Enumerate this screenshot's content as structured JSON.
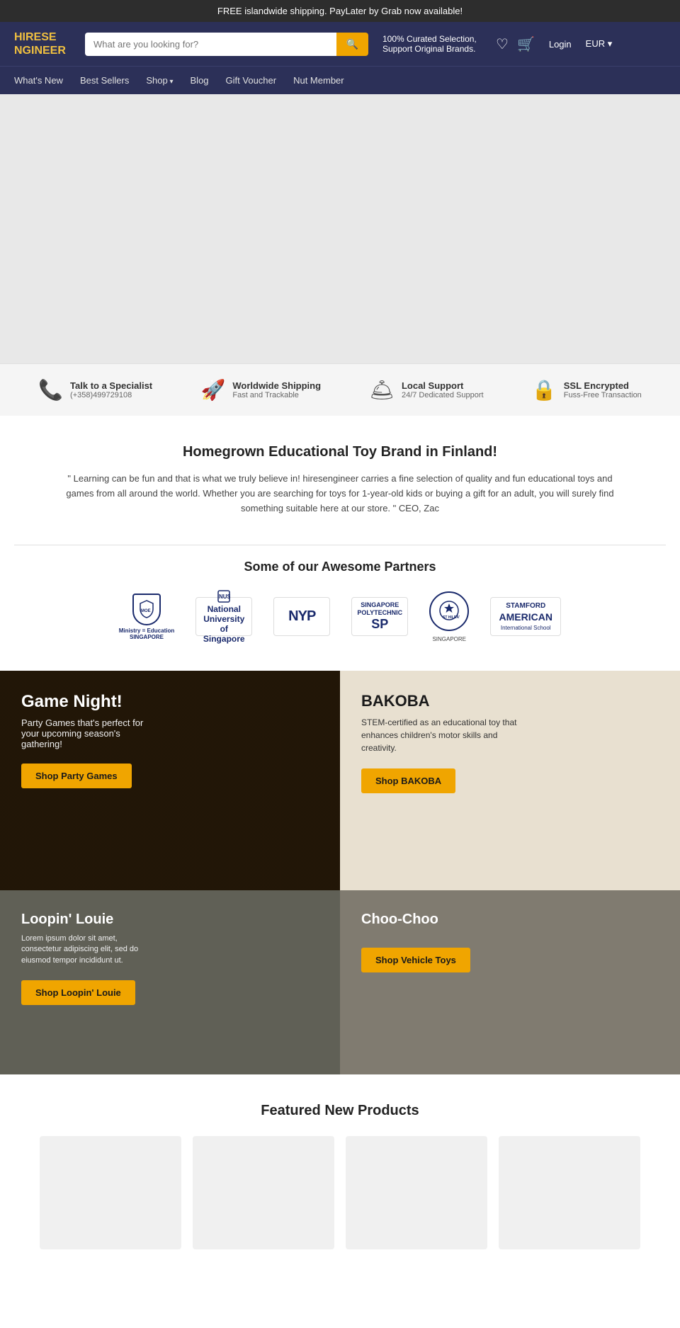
{
  "top_banner": {
    "text": "FREE islandwide shipping. PayLater by Grab now available!"
  },
  "header": {
    "logo_line1": "HIRESE",
    "logo_line2": "NGINEER",
    "search_placeholder": "What are you looking for?",
    "tagline": "100% Curated Selection, Support Original Brands.",
    "login_label": "Login",
    "currency_label": "EUR"
  },
  "nav": {
    "items": [
      {
        "label": "What's New"
      },
      {
        "label": "Best Sellers"
      },
      {
        "label": "Shop",
        "dropdown": true
      },
      {
        "label": "Blog"
      },
      {
        "label": "Gift Voucher"
      },
      {
        "label": "Nut Member"
      }
    ]
  },
  "features": [
    {
      "icon": "phone",
      "title": "Talk to a Specialist",
      "subtitle": "(+358)499729108"
    },
    {
      "icon": "rocket",
      "title": "Worldwide Shipping",
      "subtitle": "Fast and Trackable"
    },
    {
      "icon": "support",
      "title": "Local Support",
      "subtitle": "24/7 Dedicated Support"
    },
    {
      "icon": "lock",
      "title": "SSL Encrypted",
      "subtitle": "Fuss-Free Transaction"
    }
  ],
  "about": {
    "heading": "Homegrown Educational Toy Brand in Finland!",
    "description": "\" Learning can be fun and that is what we truly believe in! hiresengineer carries a fine selection of quality and fun educational toys and games from all around the world. Whether you are searching for toys for 1-year-old kids or buying a gift for an adult, you will surely find something suitable here at our store. \" CEO, Zac"
  },
  "partners": {
    "heading": "Some of our Awesome Partners",
    "logos": [
      {
        "name": "Ministry of Education Singapore"
      },
      {
        "name": "National University of Singapore"
      },
      {
        "name": "NYP"
      },
      {
        "name": "Singapore Polytechnic SP"
      },
      {
        "name": "St Hilda's School Singapore"
      },
      {
        "name": "Stamford American International School"
      }
    ]
  },
  "promo_banners": [
    {
      "id": "game-night",
      "title": "Game Night!",
      "subtitle": "Party Games that's perfect for your upcoming season's gathering!",
      "button_label": "Shop Party Games"
    },
    {
      "id": "bakoba",
      "brand": "BAKOBA",
      "description": "STEM-certified as an educational toy that enhances children's motor skills and creativity.",
      "button_label": "Shop BAKOBA"
    }
  ],
  "secondary_banners": [
    {
      "id": "loopin-louie",
      "title": "Loopin' Louie",
      "description": "Lorem ipsum dolor sit amet, consectetur adipiscing elit, sed do eiusmod tempor incididunt ut.",
      "button_label": "Shop Loopin' Louie"
    },
    {
      "id": "choo-choo",
      "title": "Choo-Choo",
      "description": "",
      "button_label": "Shop Vehicle Toys"
    }
  ],
  "featured": {
    "heading": "Featured New Products"
  }
}
